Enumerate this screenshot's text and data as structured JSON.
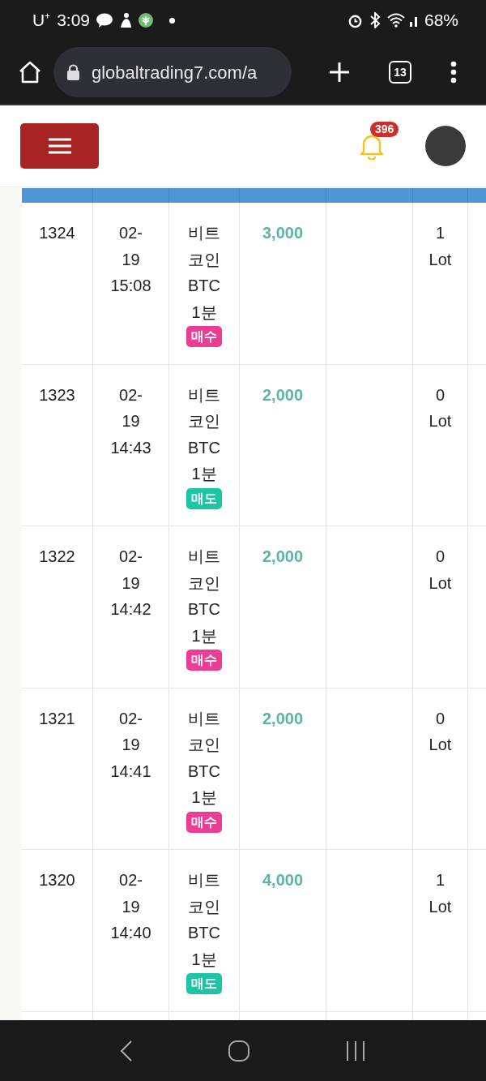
{
  "status_bar": {
    "carrier": "U⁺",
    "time": "3:09",
    "battery": "68%"
  },
  "browser": {
    "url": "globaltrading7.com/a",
    "tab_count": "13"
  },
  "header": {
    "notification_count": "396"
  },
  "table": {
    "rows": [
      {
        "id": "1324",
        "date": "02-19",
        "time": "15:08",
        "coin": "비트코인 BTC 1분",
        "side": {
          "kind": "buy",
          "label": "매수"
        },
        "amount": "3,000",
        "lot": "1 Lot"
      },
      {
        "id": "1323",
        "date": "02-19",
        "time": "14:43",
        "coin": "비트코인 BTC 1분",
        "side": {
          "kind": "sell",
          "label": "매도"
        },
        "amount": "2,000",
        "lot": "0 Lot"
      },
      {
        "id": "1322",
        "date": "02-19",
        "time": "14:42",
        "coin": "비트코인 BTC 1분",
        "side": {
          "kind": "buy",
          "label": "매수"
        },
        "amount": "2,000",
        "lot": "0 Lot"
      },
      {
        "id": "1321",
        "date": "02-19",
        "time": "14:41",
        "coin": "비트코인 BTC 1분",
        "side": {
          "kind": "buy",
          "label": "매수"
        },
        "amount": "2,000",
        "lot": "0 Lot"
      },
      {
        "id": "1320",
        "date": "02-19",
        "time": "14:40",
        "coin": "비트코인 BTC 1분",
        "side": {
          "kind": "sell",
          "label": "매도"
        },
        "amount": "4,000",
        "lot": "1 Lot"
      }
    ]
  }
}
